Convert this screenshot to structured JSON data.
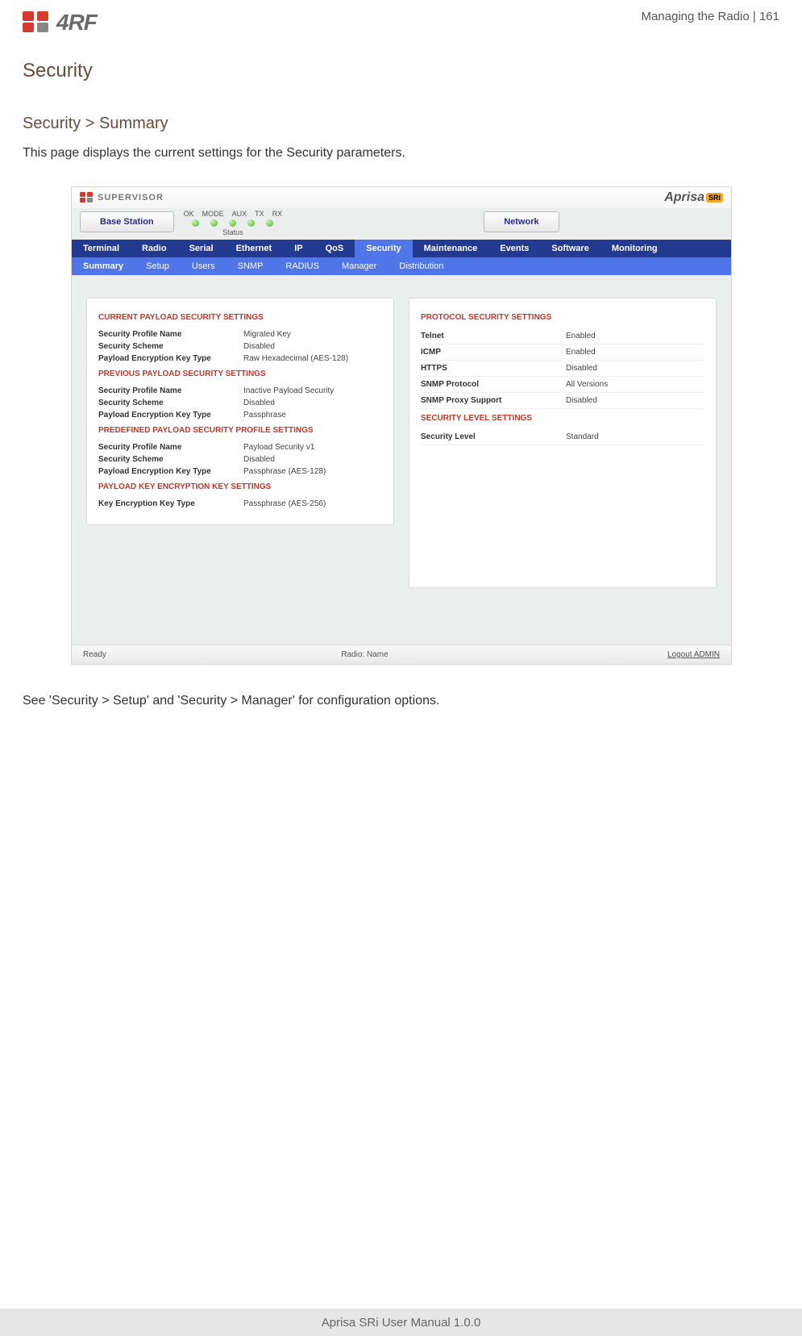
{
  "header": {
    "logo_text": "4RF",
    "right": "Managing the Radio  |  161"
  },
  "titles": {
    "h1": "Security",
    "h2": "Security > Summary",
    "intro": "This page displays the current settings for the Security parameters.",
    "outro": "See 'Security > Setup' and 'Security > Manager' for configuration options."
  },
  "footer": "Aprisa SRi User Manual 1.0.0",
  "shot": {
    "supervisor": "SUPERVISOR",
    "aprisa": "Aprisa",
    "aprisa_badge": "SRi",
    "station": "Base Station",
    "network": "Network",
    "led_labels": [
      "OK",
      "MODE",
      "AUX",
      "TX",
      "RX"
    ],
    "led_sub": "Status",
    "nav1": [
      "Terminal",
      "Radio",
      "Serial",
      "Ethernet",
      "IP",
      "QoS",
      "Security",
      "Maintenance",
      "Events",
      "Software",
      "Monitoring"
    ],
    "nav1_active": 6,
    "nav2": [
      "Summary",
      "Setup",
      "Users",
      "SNMP",
      "RADIUS",
      "Manager",
      "Distribution"
    ],
    "nav2_active": 0,
    "left": {
      "g1": {
        "title": "CURRENT PAYLOAD SECURITY SETTINGS",
        "rows": [
          {
            "k": "Security Profile Name",
            "v": "Migrated Key"
          },
          {
            "k": "Security Scheme",
            "v": "Disabled"
          },
          {
            "k": "Payload Encryption Key Type",
            "v": "Raw Hexadecimal (AES-128)"
          }
        ]
      },
      "g2": {
        "title": "PREVIOUS PAYLOAD SECURITY SETTINGS",
        "rows": [
          {
            "k": "Security Profile Name",
            "v": "Inactive Payload Security"
          },
          {
            "k": "Security Scheme",
            "v": "Disabled"
          },
          {
            "k": "Payload Encryption Key Type",
            "v": "Passphrase"
          }
        ]
      },
      "g3": {
        "title": "PREDEFINED PAYLOAD SECURITY PROFILE SETTINGS",
        "rows": [
          {
            "k": "Security Profile Name",
            "v": "Payload Security v1"
          },
          {
            "k": "Security Scheme",
            "v": "Disabled"
          },
          {
            "k": "Payload Encryption Key Type",
            "v": "Passphrase (AES-128)"
          }
        ]
      },
      "g4": {
        "title": "PAYLOAD KEY ENCRYPTION KEY SETTINGS",
        "rows": [
          {
            "k": "Key Encryption Key Type",
            "v": "Passphrase (AES-256)"
          }
        ]
      }
    },
    "right": {
      "g1": {
        "title": "PROTOCOL SECURITY SETTINGS",
        "rows": [
          {
            "k": "Telnet",
            "v": "Enabled"
          },
          {
            "k": "ICMP",
            "v": "Enabled"
          },
          {
            "k": "HTTPS",
            "v": "Disabled"
          },
          {
            "k": "SNMP Protocol",
            "v": "All Versions"
          },
          {
            "k": "SNMP Proxy Support",
            "v": "Disabled"
          }
        ]
      },
      "g2": {
        "title": "SECURITY LEVEL SETTINGS",
        "rows": [
          {
            "k": "Security Level",
            "v": "Standard"
          }
        ]
      }
    },
    "foot": {
      "left": "Ready",
      "center": "Radio: Name",
      "right": "Logout ADMIN"
    }
  }
}
